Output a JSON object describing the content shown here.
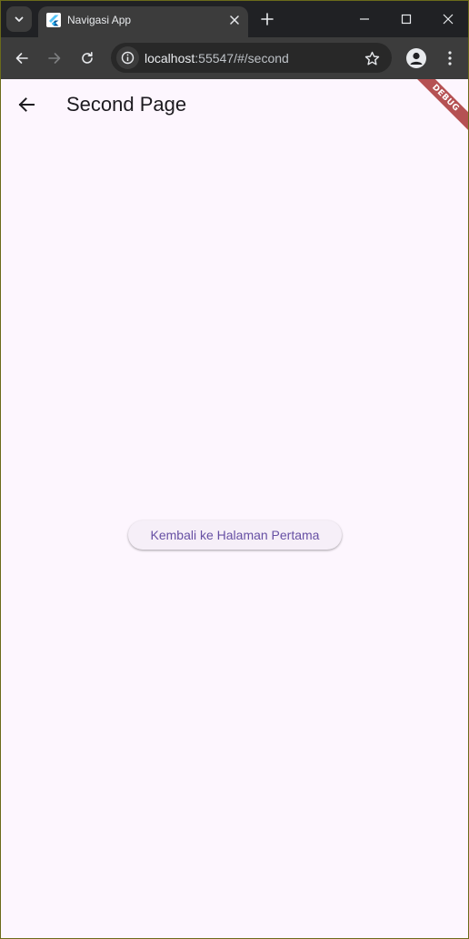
{
  "browser": {
    "tab": {
      "title": "Navigasi App",
      "favicon": "flutter-icon"
    },
    "address_bar": {
      "host": "localhost",
      "path": ":55547/#/second"
    },
    "icons": {
      "tab_search": "chevron-down-icon",
      "tab_close": "close-icon",
      "new_tab": "plus-icon",
      "minimize": "minimize-icon",
      "maximize": "maximize-icon",
      "close_window": "close-icon",
      "back": "arrow-left-icon",
      "forward": "arrow-right-icon",
      "reload": "reload-icon",
      "site_info": "info-icon",
      "bookmark": "star-icon",
      "profile": "person-icon",
      "menu": "more-vertical-icon"
    }
  },
  "app": {
    "appbar": {
      "title": "Second Page",
      "back_icon": "arrow-left-icon"
    },
    "debug_banner": "DEBUG",
    "button": {
      "label": "Kembali ke Halaman Pertama"
    }
  },
  "colors": {
    "page_background": "#fdf6fe",
    "button_background": "#f6eff8",
    "button_text": "#6750a4",
    "title_text": "#1d1b20",
    "debug_banner": "#a02323",
    "chrome_dark": "#202124",
    "chrome_toolbar": "#3c3c3c"
  }
}
